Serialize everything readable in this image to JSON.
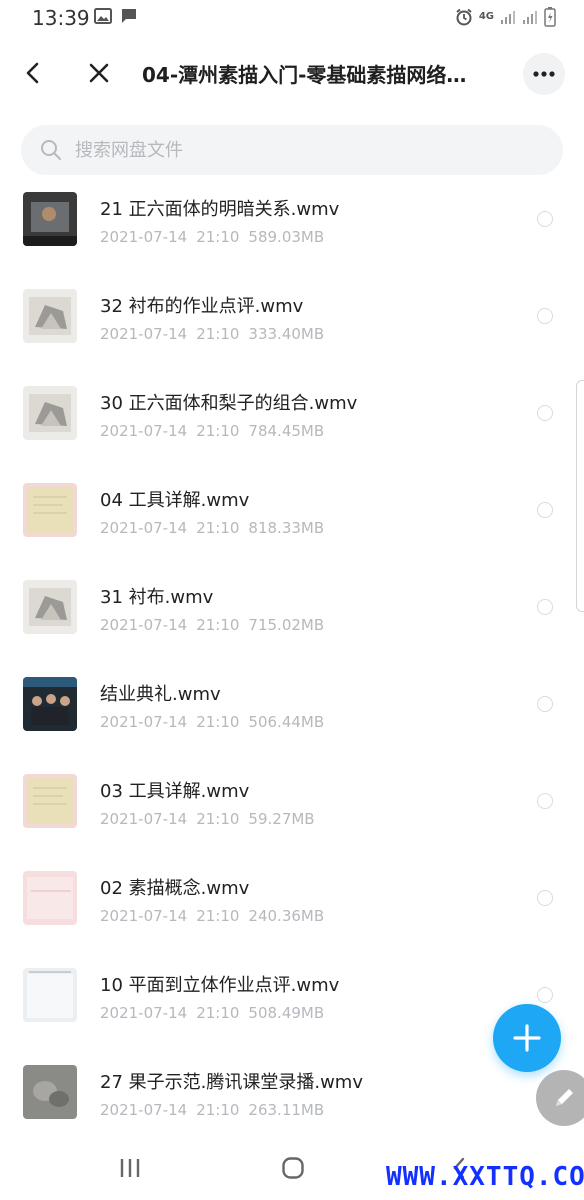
{
  "status_bar": {
    "time": "13:39",
    "icons_left": [
      "image-icon",
      "message-icon"
    ],
    "icons_right": [
      "alarm-icon",
      "4g-icon",
      "signal-icon",
      "signal-icon",
      "battery-icon"
    ],
    "network_label": "4G"
  },
  "header": {
    "title": "04-潭州素描入门-零基础素描网络…"
  },
  "search": {
    "placeholder": "搜索网盘文件",
    "value": ""
  },
  "files": [
    {
      "name": "21 正六面体的明暗关系.wmv",
      "date": "2021-07-14",
      "time": "21:10",
      "size": "589.03MB",
      "thumb": "dark"
    },
    {
      "name": "32 衬布的作业点评.wmv",
      "date": "2021-07-14",
      "time": "21:10",
      "size": "333.40MB",
      "thumb": "sketch"
    },
    {
      "name": "30 正六面体和梨子的组合.wmv",
      "date": "2021-07-14",
      "time": "21:10",
      "size": "784.45MB",
      "thumb": "sketch"
    },
    {
      "name": "04 工具详解.wmv",
      "date": "2021-07-14",
      "time": "21:10",
      "size": "818.33MB",
      "thumb": "paper"
    },
    {
      "name": "31 衬布.wmv",
      "date": "2021-07-14",
      "time": "21:10",
      "size": "715.02MB",
      "thumb": "sketch"
    },
    {
      "name": "结业典礼.wmv",
      "date": "2021-07-14",
      "time": "21:10",
      "size": "506.44MB",
      "thumb": "people"
    },
    {
      "name": "03 工具详解.wmv",
      "date": "2021-07-14",
      "time": "21:10",
      "size": "59.27MB",
      "thumb": "paper"
    },
    {
      "name": "02 素描概念.wmv",
      "date": "2021-07-14",
      "time": "21:10",
      "size": "240.36MB",
      "thumb": "pink"
    },
    {
      "name": "10 平面到立体作业点评.wmv",
      "date": "2021-07-14",
      "time": "21:10",
      "size": "508.49MB",
      "thumb": "light"
    },
    {
      "name": "27 果子示范.腾讯课堂录播.wmv",
      "date": "2021-07-14",
      "time": "21:10",
      "size": "263.11MB",
      "thumb": "gray"
    }
  ],
  "fab": {
    "icon": "plus-icon",
    "color": "#1ea7f4"
  },
  "edit_fab": {
    "icon": "pencil-icon"
  },
  "nav": {
    "icons": [
      "recents-icon",
      "home-icon",
      "back-icon"
    ]
  },
  "watermark": "WWW.XXTTQ.COM"
}
